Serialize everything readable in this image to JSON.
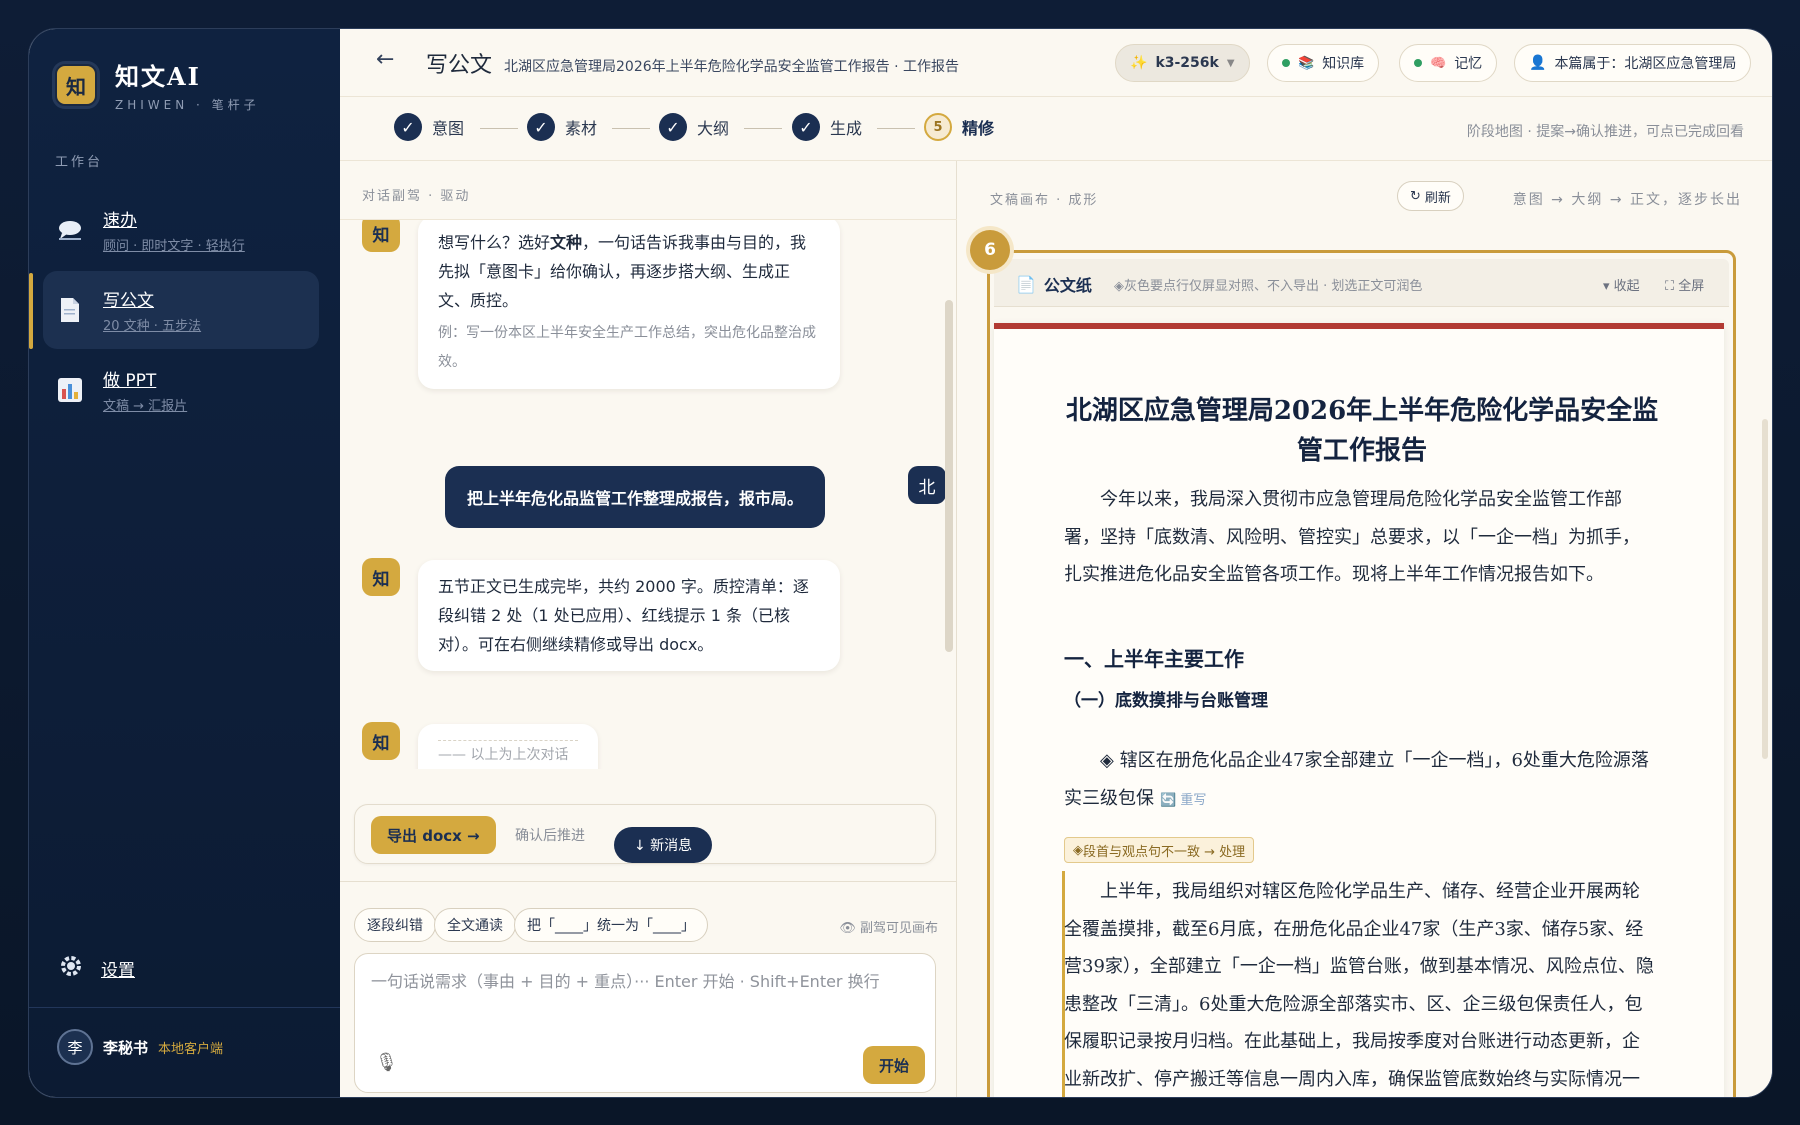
{
  "app": {
    "name": "知文AI",
    "subtitle": "ZHIWEN · 笔杆子",
    "logo_glyph": "知"
  },
  "sidebar": {
    "section_label": "工作台",
    "items": [
      {
        "title": "速办",
        "sub": "顾问 · 即时文字 · 轻执行",
        "icon": "chat-bubble-icon"
      },
      {
        "title": "写公文",
        "sub": "20 文种 · 五步法",
        "icon": "document-icon",
        "active": true
      },
      {
        "title": "做 PPT",
        "sub": "文稿 → 汇报片",
        "icon": "bar-chart-icon"
      }
    ],
    "settings_label": "设置",
    "user": {
      "avatar": "李",
      "name": "李秘书",
      "tag": "本地客户端"
    }
  },
  "header": {
    "back": "←",
    "page_title": "写公文",
    "doc_title": "北湖区应急管理局2026年上半年危险化学品安全监管工作报告 · 工作报告",
    "model": "k3-256k",
    "knowledge": "知识库",
    "memory": "记忆",
    "owner": "本篇属于：北湖区应急管理局"
  },
  "stepper": {
    "steps": [
      {
        "label": "意图",
        "mark": "✓"
      },
      {
        "label": "素材",
        "mark": "✓"
      },
      {
        "label": "大纲",
        "mark": "✓"
      },
      {
        "label": "生成",
        "mark": "✓"
      },
      {
        "label": "精修",
        "mark": "5"
      }
    ],
    "hint": "阶段地图 · 提案→确认推进，可点已完成回看"
  },
  "chat": {
    "label": "对话副驾 · 驱动",
    "bot_badge": "知",
    "user_badge": "北",
    "messages": [
      {
        "role": "bot",
        "text_a": "想写什么？选好",
        "text_bold": "文种",
        "text_b": "，一句话告诉我事由与目的，我先拟「意图卡」给你确认，再逐步搭大纲、生成正文、质控。",
        "hint": "例：写一份本区上半年安全生产工作总结，突出危化品整治成效。"
      },
      {
        "role": "user",
        "text": "把上半年危化品监管工作整理成报告，报市局。"
      },
      {
        "role": "bot",
        "text": "五节正文已生成完毕，共约 2000 字。质控清单：逐段纠错 2 处（1 处已应用）、红线提示 1 条（已核对）。可在右侧继续精修或导出 docx。"
      },
      {
        "role": "bot",
        "text": "—— 以上为上次对话"
      }
    ],
    "export_label": "导出 docx →",
    "confirm_text": "确认后推进",
    "new_message": "↓ 新消息",
    "chips": [
      "逐段纠错",
      "全文通读",
      "把「____」统一为「____」"
    ],
    "visible_note": "副驾可见画布",
    "input_placeholder": "一句话说需求（事由 + 目的 + 重点）··· Enter 开始 · Shift+Enter 换行",
    "start_label": "开始"
  },
  "canvas": {
    "label": "文稿画布 · 成形",
    "refresh": "刷新",
    "flow": "意图 → 大纲 → 正文，逐步长出",
    "badge": "6",
    "paper_title": "公文纸",
    "paper_note": "灰色要点行仅屏显对照、不入导出 · 划选正文可润色",
    "collapse": "收起",
    "fullscreen": "全屏"
  },
  "document": {
    "title": "北湖区应急管理局2026年上半年危险化学品安全监管工作报告",
    "intro": "今年以来，我局深入贯彻市应急管理局危险化学品安全监管工作部署，坚持「底数清、风险明、管控实」总要求，以「一企一档」为抓手，扎实推进危化品安全监管各项工作。现将上半年工作情况报告如下。",
    "section1": "一、上半年主要工作",
    "sub1": "（一）底数摸排与台账管理",
    "point1": "◈ 辖区在册危化品企业47家全部建立「一企一档」，6处重大危险源落实三级包保",
    "rewrite": "重写",
    "warning": "段首与观点句不一致 → 处理",
    "para1": "上半年，我局组织对辖区危险化学品生产、储存、经营企业开展两轮全覆盖摸排，截至6月底，在册危化品企业47家（生产3家、储存5家、经营39家），全部建立「一企一档」监管台账，做到基本情况、风险点位、隐患整改「三清」。6处重大危险源全部落实市、区、企三级包保责任人，包保履职记录按月归档。在此基础上，我局按季度对台账进行动态更新，企业新改扩、停产搬迁等信息一周内入库，确保监管底数始终与实际情况一致。各街道安监办同步建立辖区分册，区街两级台账"
  },
  "colors": {
    "navy": "#1b2f52",
    "gold": "#d4a93f",
    "paper_red": "#b23a33",
    "status_green": "#2f9e62"
  }
}
